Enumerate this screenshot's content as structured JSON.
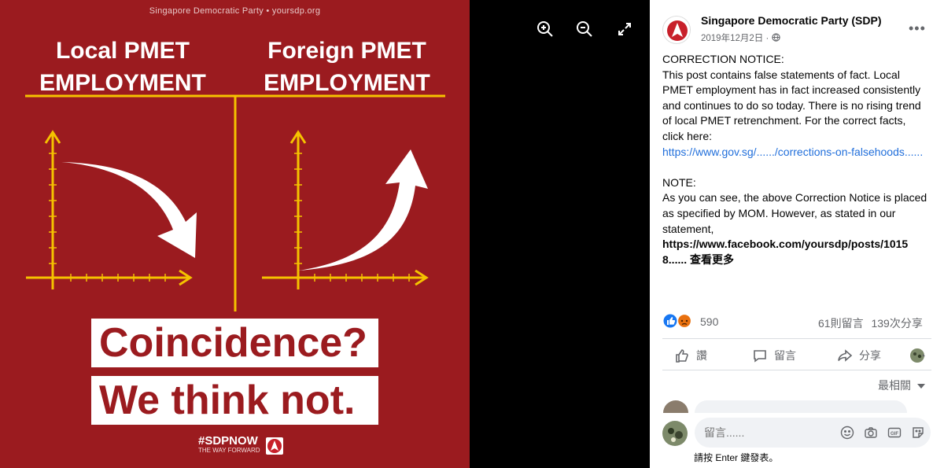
{
  "poster": {
    "header": "Singapore Democratic Party • yoursdp.org",
    "left_title": "Local PMET EMPLOYMENT",
    "right_title": "Foreign PMET EMPLOYMENT",
    "big_line_1": "Coincidence?",
    "big_line_2": "We think not.",
    "hashtag": "#SDPNOW",
    "tagline": "THE WAY FORWARD"
  },
  "toolbar": {
    "zoom_in": "zoom-in-icon",
    "zoom_out": "zoom-out-icon",
    "fullscreen": "fullscreen-icon"
  },
  "post": {
    "page_name": "Singapore Democratic Party (SDP)",
    "date": "2019年12月2日 ·",
    "more": "•••",
    "correction_heading": "CORRECTION NOTICE:",
    "correction_text": "This post contains false statements of fact. Local PMET employment has in fact increased consistently and continues to do so today. There is no rising trend of local PMET retrenchment. For the correct facts, click here:",
    "correction_link": "https://www.gov.sg/....../corrections-on-falsehoods......",
    "note_heading": "NOTE:",
    "note_text": "As you can see, the above Correction Notice is placed as specified by MOM. However, as stated in our statement,",
    "note_link": "https://www.facebook.com/yoursdp/posts/10158......",
    "see_more": "查看更多",
    "reaction_count": "590",
    "comments_count": "61則留言",
    "shares_count": "139次分享"
  },
  "actions": {
    "like": "讚",
    "comment": "留言",
    "share": "分享"
  },
  "comments": {
    "sort_label": "最相關",
    "placeholder": "留言......",
    "hint": "請按 Enter 鍵發表。"
  },
  "colors": {
    "poster_red": "#9b1b1f",
    "axis_yellow": "#f5c200",
    "link_blue": "#216fdb"
  }
}
